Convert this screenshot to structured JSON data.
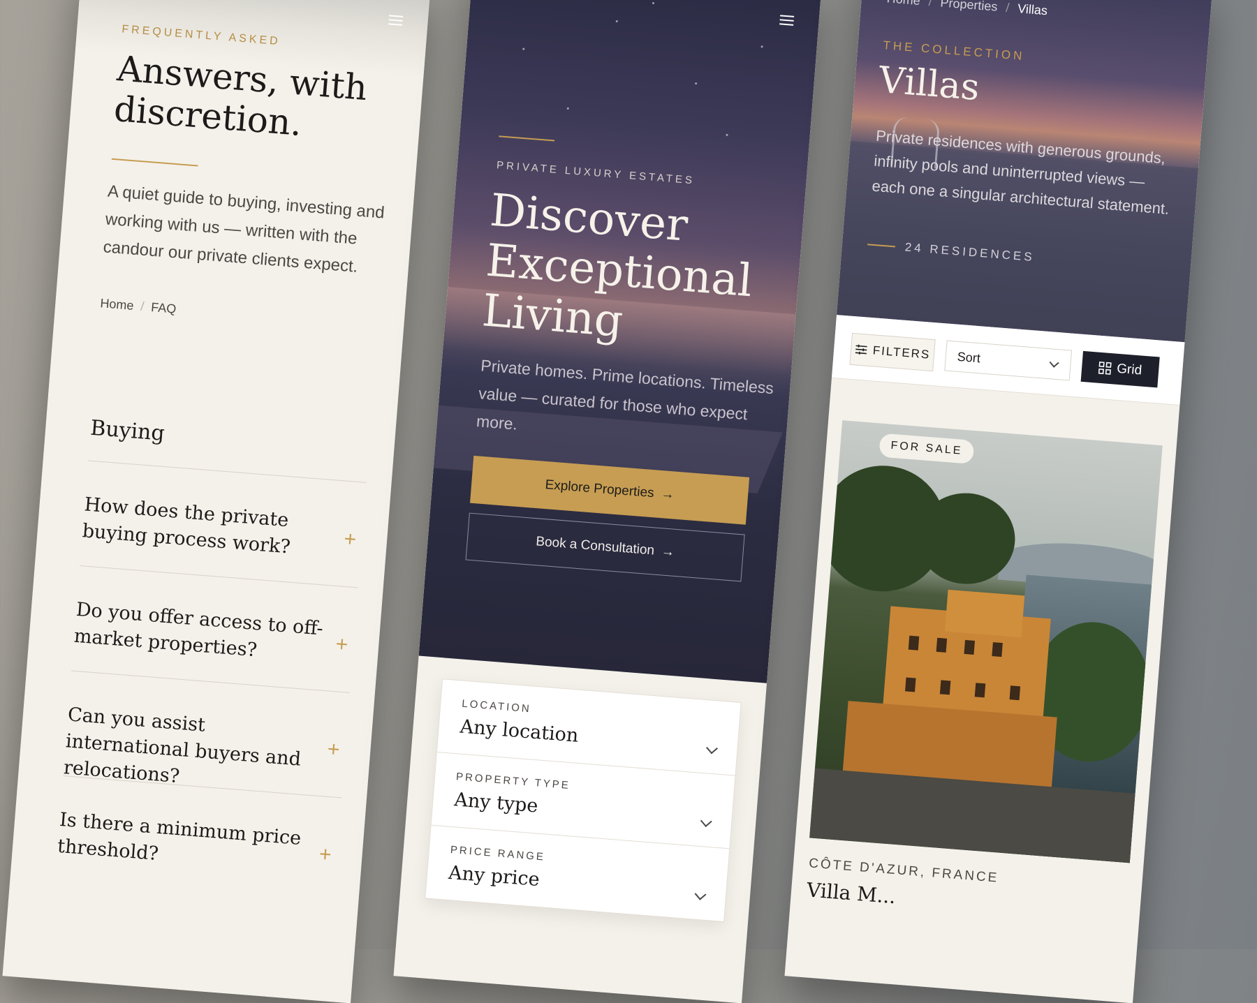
{
  "faq": {
    "eyebrow": "FREQUENTLY ASKED",
    "title": "Answers, with discretion.",
    "intro": "A quiet guide to buying, investing and working with us — written with the candour our private clients expect.",
    "breadcrumb": {
      "home": "Home",
      "separator": "/",
      "current": "FAQ"
    },
    "section": "Buying",
    "questions": [
      "How does the private buying process work?",
      "Do you offer access to off-market properties?",
      "Can you assist international buyers and relocations?",
      "Is there a minimum price threshold?"
    ],
    "expand_symbol": "+"
  },
  "hero": {
    "eyebrow": "PRIVATE LUXURY ESTATES",
    "title": "Discover Exceptional Living",
    "lead": "Private homes. Prime locations. Timeless value — curated for those who expect more.",
    "primary_cta": "Explore Properties",
    "secondary_cta": "Book a Consultation",
    "arrow": "→"
  },
  "search": {
    "fields": [
      {
        "label": "LOCATION",
        "value": "Any location"
      },
      {
        "label": "PROPERTY TYPE",
        "value": "Any type"
      },
      {
        "label": "PRICE RANGE",
        "value": "Any price"
      }
    ]
  },
  "villas": {
    "breadcrumb": {
      "home": "Home",
      "properties": "Properties",
      "current": "Villas",
      "separator": "/"
    },
    "eyebrow": "THE COLLECTION",
    "title": "Villas",
    "lead": "Private residences with generous grounds, infinity pools and uninterrupted views — each one a singular architectural statement.",
    "count": "24 RESIDENCES",
    "toolbar": {
      "filters": "FILTERS",
      "sort": "Sort",
      "grid": "Grid"
    },
    "listing": {
      "badge": "FOR SALE",
      "location": "CÔTE D'AZUR, FRANCE",
      "name": "Villa M..."
    }
  },
  "colors": {
    "accent": "#c69d52",
    "ink": "#1d1b1a",
    "paper": "#f4f1ea",
    "navy": "#1d1f2b"
  },
  "icons": [
    "menu-icon",
    "plus-icon",
    "arrow-right-icon",
    "chevron-down-icon",
    "sliders-icon",
    "grid-icon"
  ]
}
